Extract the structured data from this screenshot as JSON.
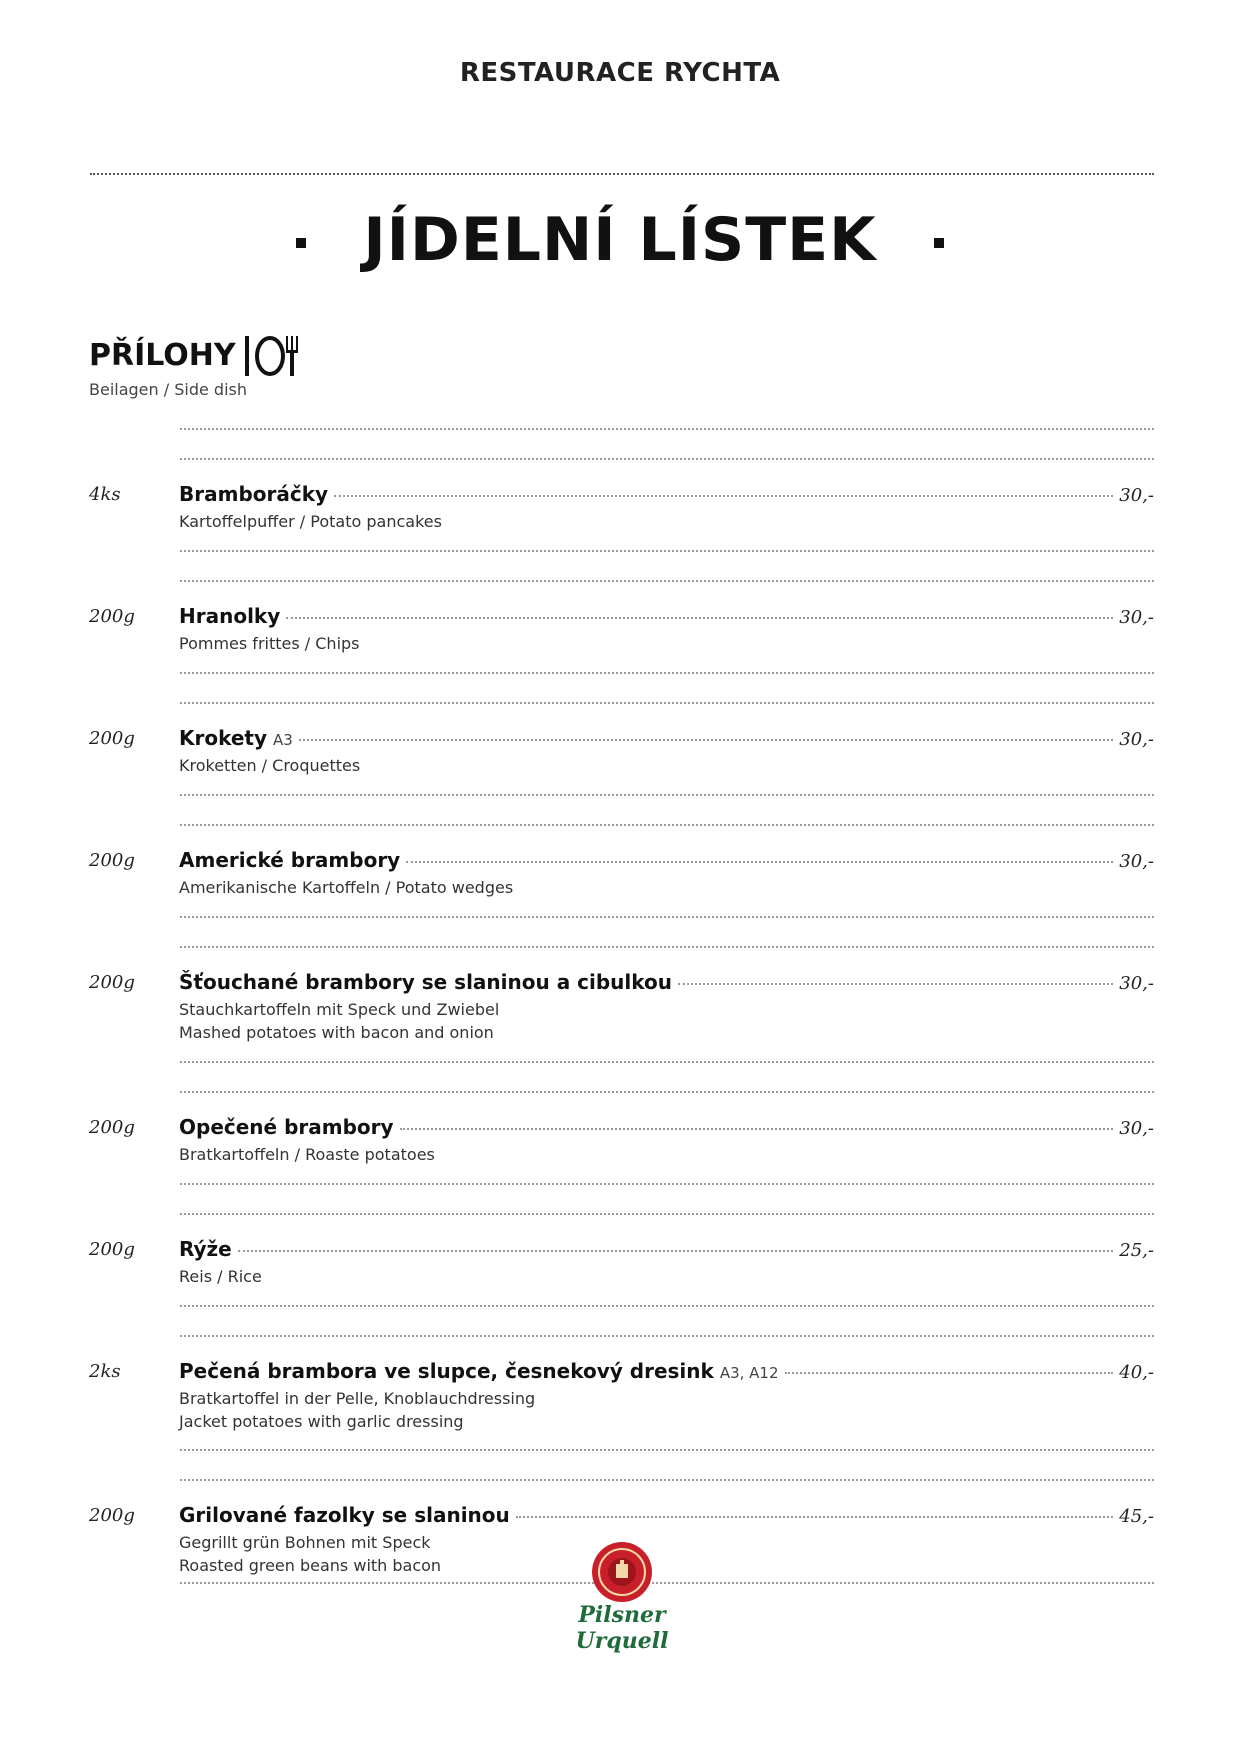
{
  "header": {
    "restaurant_name": "RESTAURACE RYCHTA"
  },
  "title": {
    "text": "JÍDELNÍ LÍSTEK",
    "dot_left": "·",
    "dot_right": "·"
  },
  "section": {
    "title": "PŘÍLOHY",
    "icon": "plate-fork-knife-icon",
    "subtitle": "Beilagen / Side dish"
  },
  "items": [
    {
      "qty": "4ks",
      "name": "Bramboráčky",
      "allergens": "",
      "price": "30,-",
      "desc": [
        "Kartoffelpuffer / Potato pancakes"
      ]
    },
    {
      "qty": "200g",
      "name": "Hranolky",
      "allergens": "",
      "price": "30,-",
      "desc": [
        "Pommes frittes / Chips"
      ]
    },
    {
      "qty": "200g",
      "name": "Krokety",
      "allergens": "A3",
      "price": "30,-",
      "desc": [
        "Kroketten / Croquettes"
      ]
    },
    {
      "qty": "200g",
      "name": "Americké brambory",
      "allergens": "",
      "price": "30,-",
      "desc": [
        "Amerikanische Kartoffeln / Potato wedges"
      ]
    },
    {
      "qty": "200g",
      "name": "Šťouchané brambory se slaninou a cibulkou",
      "allergens": "",
      "price": "30,-",
      "desc": [
        "Stauchkartoffeln mit Speck und Zwiebel",
        "Mashed potatoes with bacon and onion"
      ]
    },
    {
      "qty": "200g",
      "name": "Opečené brambory",
      "allergens": "",
      "price": "30,-",
      "desc": [
        "Bratkartoffeln / Roaste potatoes"
      ]
    },
    {
      "qty": "200g",
      "name": "Rýže",
      "allergens": "",
      "price": "25,-",
      "desc": [
        "Reis / Rice"
      ]
    },
    {
      "qty": "2ks",
      "name": "Pečená brambora ve slupce, česnekový dresink",
      "allergens": "A3, A12",
      "price": "40,-",
      "desc": [
        "Bratkartoffel in der Pelle, Knoblauchdressing",
        "Jacket potatoes with garlic dressing"
      ]
    },
    {
      "qty": "200g",
      "name": "Grilované fazolky se slaninou",
      "allergens": "",
      "price": "45,-",
      "desc": [
        "Gegrillt grün Bohnen mit Speck",
        "Roasted green beans with bacon"
      ]
    }
  ],
  "footer": {
    "logo_text": "Pilsner Urquell",
    "logo_icon": "pilsner-urquell-seal-logo"
  },
  "colors": {
    "text": "#111111",
    "logo_red": "#c8202a",
    "logo_green": "#1f6b3a"
  }
}
